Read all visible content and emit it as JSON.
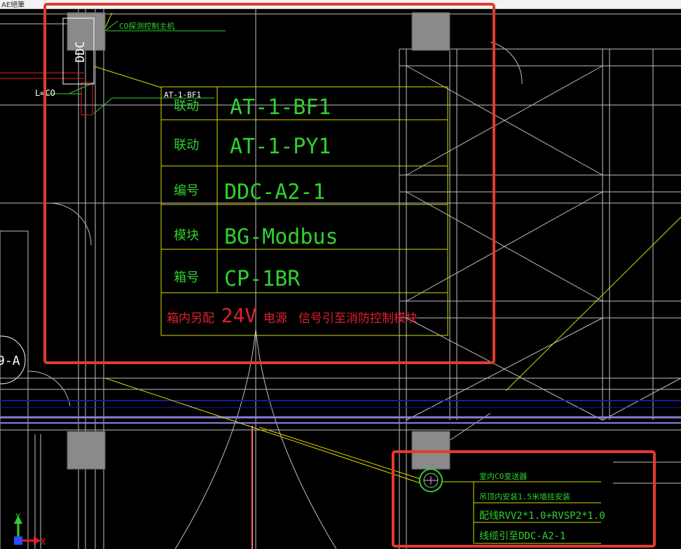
{
  "window": {
    "title": "AE絕筆"
  },
  "colors": {
    "background": "#000000",
    "table_line": "#d8d800",
    "green_text": "#2fd12f",
    "red_text": "#e0202b",
    "highlight": "#e23a2e",
    "wall": "#cfcfcf"
  },
  "labels": {
    "co_host": "CO探测控制主机",
    "ddc": "DDC",
    "co_left": "L=CO",
    "small_header": "AT-1-BF1",
    "zone_a": "9-A"
  },
  "main_table": {
    "rows": [
      {
        "key": "联动",
        "value": "AT-1-BF1"
      },
      {
        "key": "联动",
        "value": "AT-1-PY1"
      },
      {
        "key": "编号",
        "value": "DDC-A2-1"
      },
      {
        "key": "模块",
        "value": "BG-Modbus"
      },
      {
        "key": "箱号",
        "value": "CP-1BR"
      }
    ],
    "footer": {
      "prefix": "箱内另配",
      "voltage": "24V",
      "suffix": "电源",
      "signal": "信号引至消防控制模块"
    }
  },
  "sensor_table": {
    "rows": [
      "室内CO变送器",
      "吊顶内安装1.5米墙挂安装",
      "配线RVV2*1.0+RVSP2*1.0",
      "线缆引至DDC-A2-1"
    ]
  },
  "axes": {
    "y_label": "Y",
    "x_label": "X"
  }
}
